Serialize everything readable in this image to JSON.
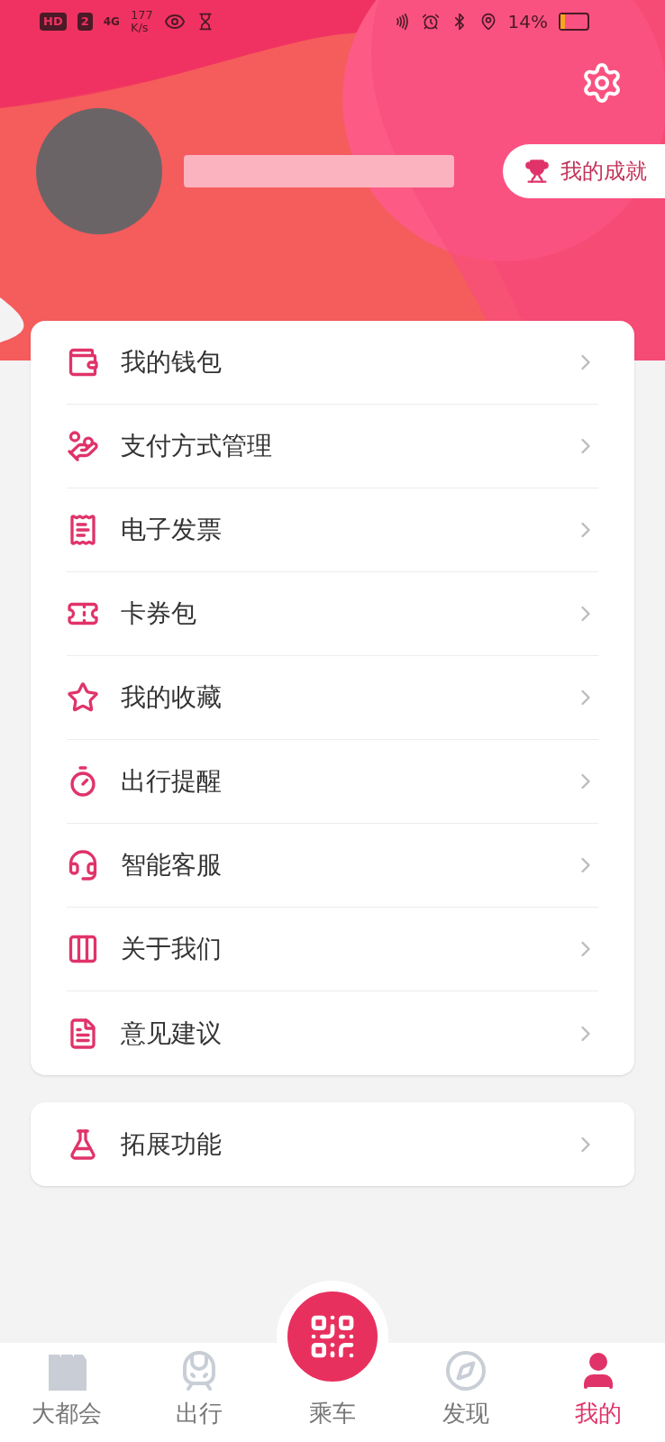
{
  "status_bar": {
    "hd": "HD",
    "sim": "2",
    "network": "4G",
    "speed": "177",
    "speed_unit": "K/s",
    "battery": "14%"
  },
  "profile": {
    "achievement_button": "我的成就"
  },
  "menu_items": [
    {
      "kind": "wallet",
      "label": "我的钱包"
    },
    {
      "kind": "payment",
      "label": "支付方式管理"
    },
    {
      "kind": "invoice",
      "label": "电子发票"
    },
    {
      "kind": "coupon",
      "label": "卡券包"
    },
    {
      "kind": "favorite",
      "label": "我的收藏"
    },
    {
      "kind": "reminder",
      "label": "出行提醒"
    },
    {
      "kind": "service",
      "label": "智能客服"
    },
    {
      "kind": "about",
      "label": "关于我们"
    },
    {
      "kind": "feedback",
      "label": "意见建议"
    }
  ],
  "extra_items": [
    {
      "kind": "extension",
      "label": "拓展功能"
    }
  ],
  "nav": [
    {
      "kind": "metro",
      "label": "大都会",
      "selected": false
    },
    {
      "kind": "travel",
      "label": "出行",
      "selected": false
    },
    {
      "kind": "ride",
      "label": "乘车",
      "selected": false
    },
    {
      "kind": "discover",
      "label": "发现",
      "selected": false
    },
    {
      "kind": "mine",
      "label": "我的",
      "selected": true
    }
  ]
}
